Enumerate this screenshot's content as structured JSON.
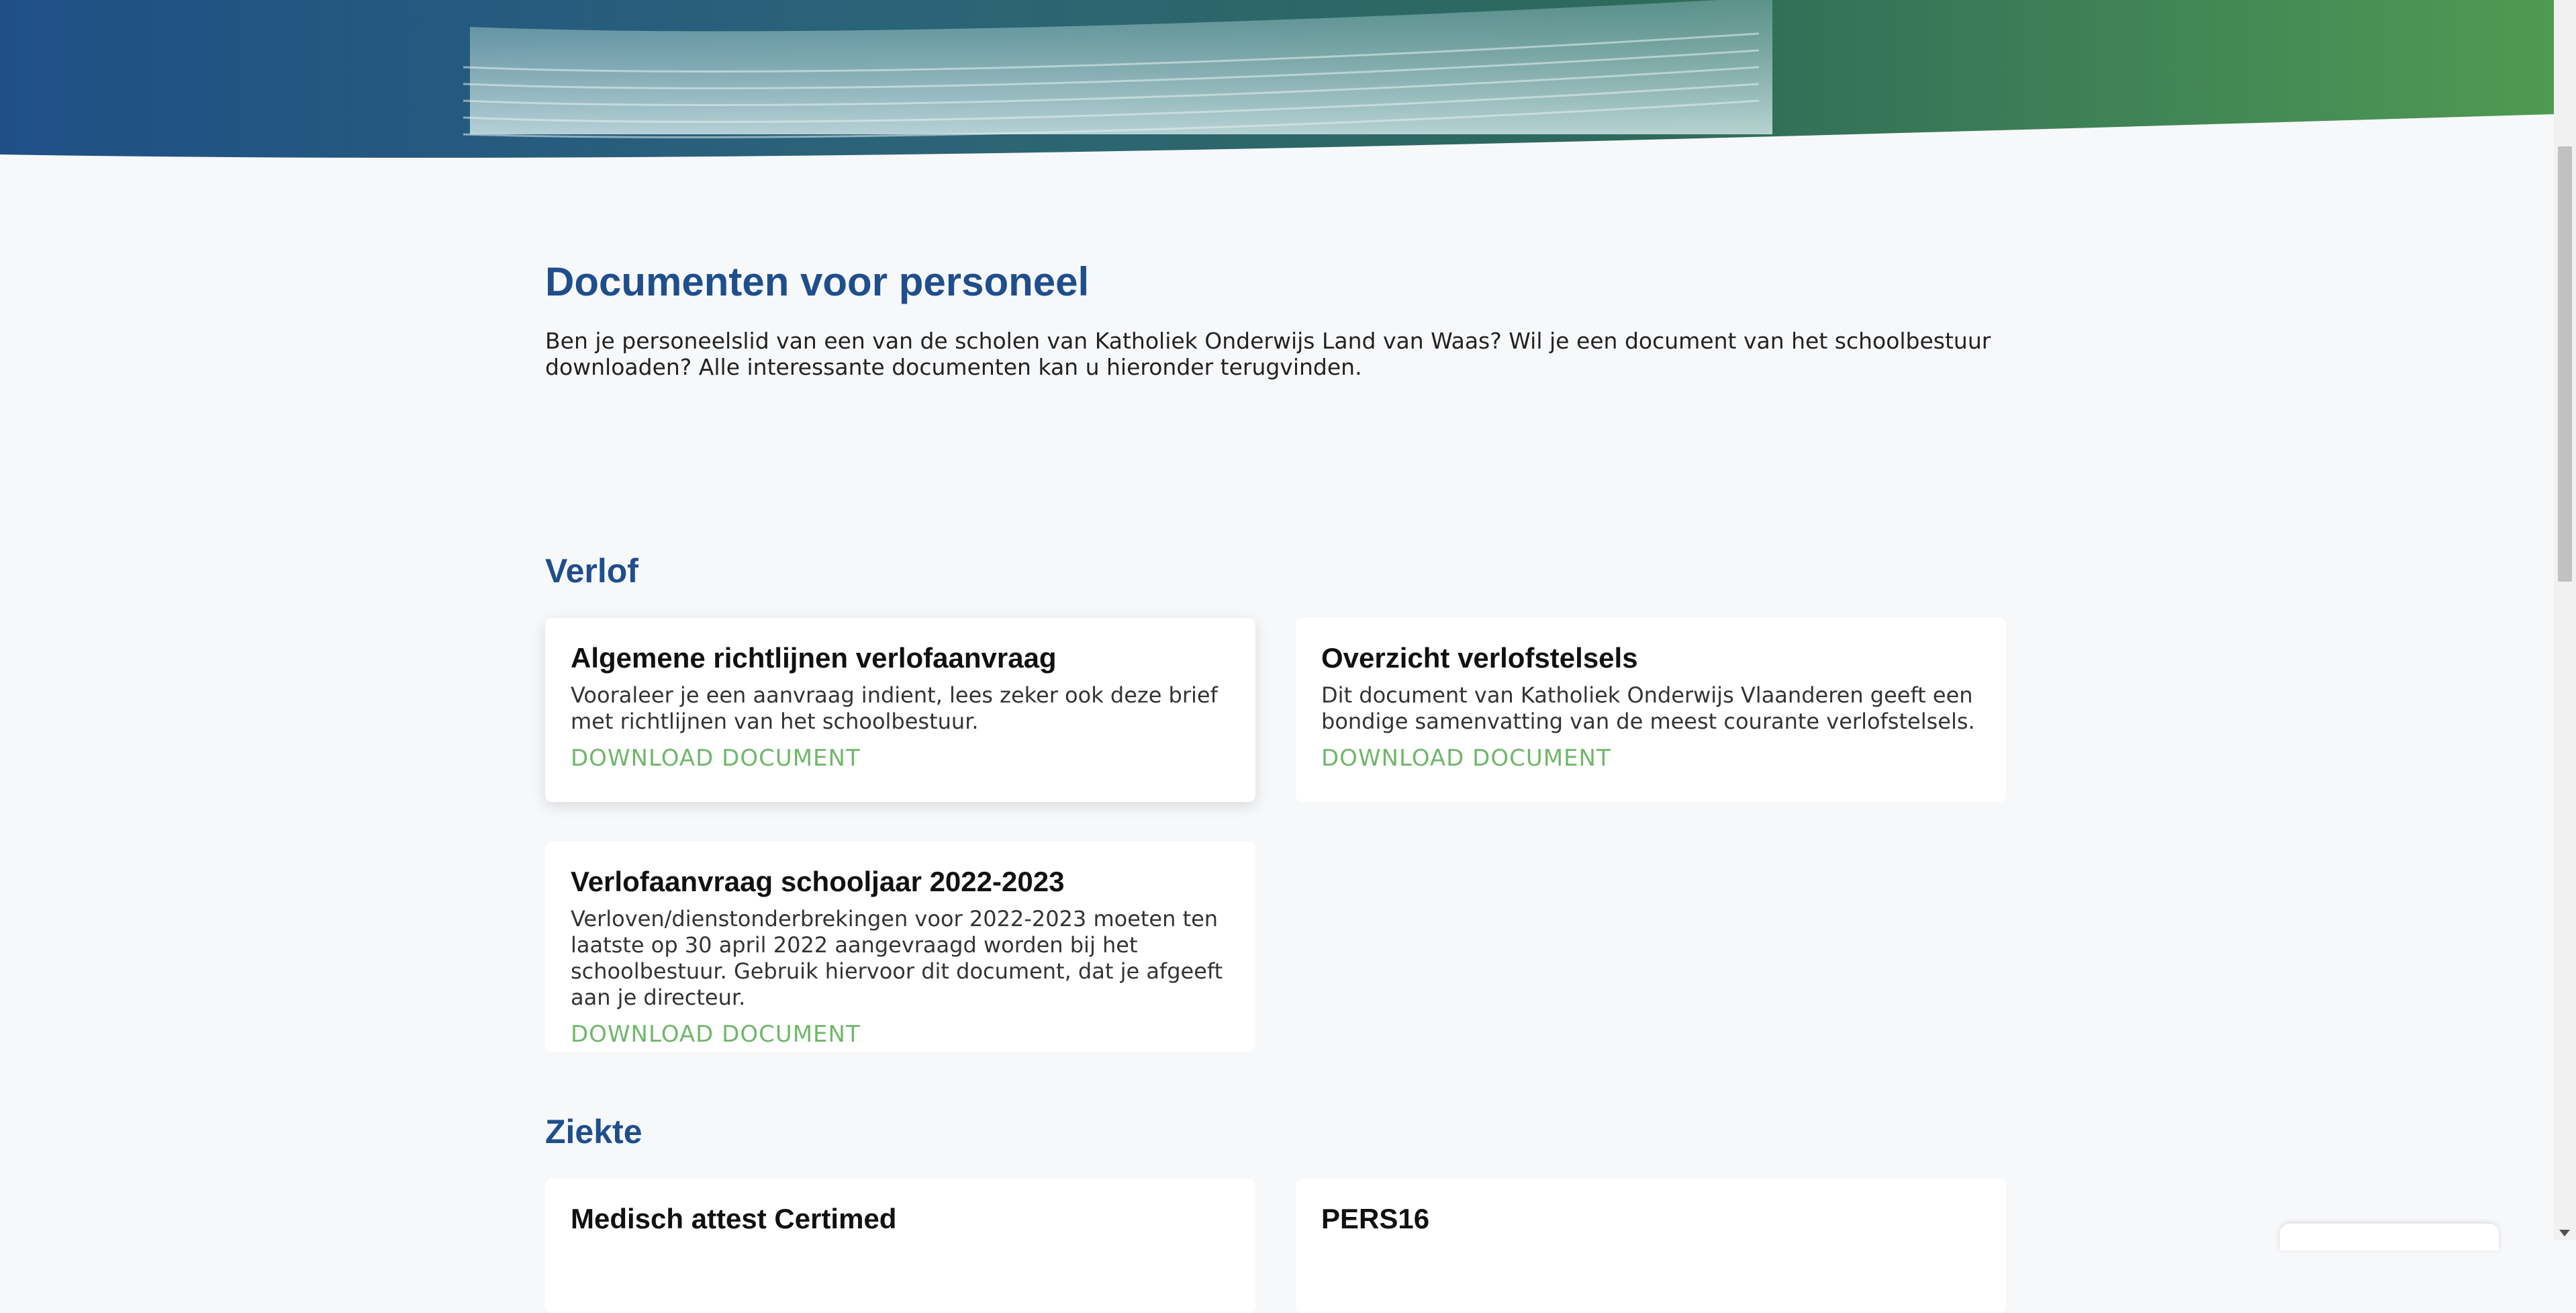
{
  "page": {
    "title": "Documenten voor personeel",
    "intro": "Ben je personeelslid van een van de scholen van Katholiek Onderwijs Land van Waas? Wil je een document van het schoolbestuur downloaden? Alle interessante documenten kan u hieronder terugvinden."
  },
  "sections": [
    {
      "title": "Verlof",
      "cards": [
        {
          "title": "Algemene richtlijnen verlofaanvraag",
          "text": "Vooraleer je een aanvraag indient, lees zeker ook deze brief met richtlijnen van het schoolbestuur.",
          "link": "DOWNLOAD DOCUMENT"
        },
        {
          "title": "Overzicht verlofstelsels",
          "text": "Dit document van Katholiek Onderwijs Vlaanderen geeft een bondige samenvatting van de meest courante verlofstelsels.",
          "link": "DOWNLOAD DOCUMENT"
        },
        {
          "title": "Verlofaanvraag schooljaar 2022-2023",
          "text": "Verloven/dienstonderbrekingen voor 2022-2023 moeten ten laatste op 30 april 2022 aangevraagd worden bij het schoolbestuur. Gebruik hiervoor dit document, dat je afgeeft aan je directeur.",
          "link": "DOWNLOAD DOCUMENT"
        }
      ]
    },
    {
      "title": "Ziekte",
      "cards": [
        {
          "title": "Medisch attest Certimed"
        },
        {
          "title": "PERS16"
        }
      ]
    }
  ],
  "colors": {
    "heading": "#1f4e8c",
    "link": "#6fb769",
    "background": "#f7f8fa",
    "card": "#ffffff"
  }
}
